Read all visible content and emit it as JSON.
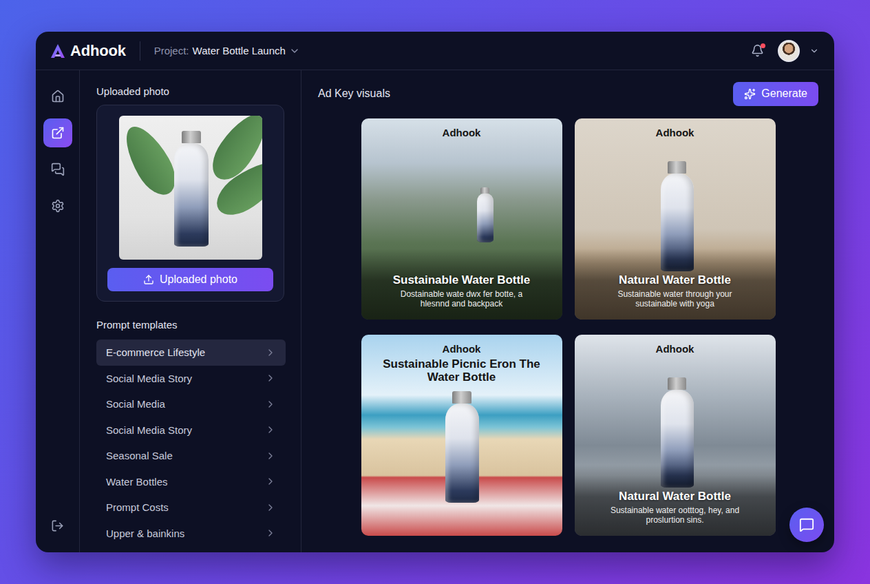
{
  "app": {
    "logo": "Adhook"
  },
  "project": {
    "label": "Project:",
    "name": "Water Bottle Launch"
  },
  "notifications": {
    "unread": true
  },
  "rail": {
    "items": [
      {
        "selected": false
      },
      {
        "selected": true
      },
      {
        "selected": false
      },
      {
        "selected": false
      }
    ]
  },
  "upload": {
    "title": "Uploaded photo",
    "button": "Uploaded photo"
  },
  "templates": {
    "title": "Prompt templates",
    "items": [
      {
        "label": "E-commerce Lifestyle",
        "selected": true
      },
      {
        "label": "Social Media Story",
        "selected": false
      },
      {
        "label": "Social Media",
        "selected": false
      },
      {
        "label": "Social Media Story",
        "selected": false
      },
      {
        "label": "Seasonal Sale",
        "selected": false
      },
      {
        "label": "Water Bottles",
        "selected": false
      },
      {
        "label": "Prompt Costs",
        "selected": false
      },
      {
        "label": "Upper & bainkins",
        "selected": false
      }
    ]
  },
  "visuals": {
    "title": "Ad Key visuals",
    "generate": "Generate",
    "cards": [
      {
        "kind": "caption-bottom",
        "brand": "Adhook",
        "title": "Sustainable Water Bottle",
        "subtitle": "Dostainable wate dwx fer botte, a hlesnnd and backpack"
      },
      {
        "kind": "caption-bottom",
        "brand": "Adhook",
        "title": "Natural Water Bottle",
        "subtitle": "Sustainable water through your sustainable with yoga"
      },
      {
        "kind": "caption-top",
        "brand": "Adhook",
        "title": "Sustainable Picnic Eron The Water Bottle"
      },
      {
        "kind": "caption-bottom",
        "brand": "Adhook",
        "title": "Natural Water Bottle",
        "subtitle": "Sustainable water ootttog, hey, and proslurtion sins."
      }
    ]
  }
}
